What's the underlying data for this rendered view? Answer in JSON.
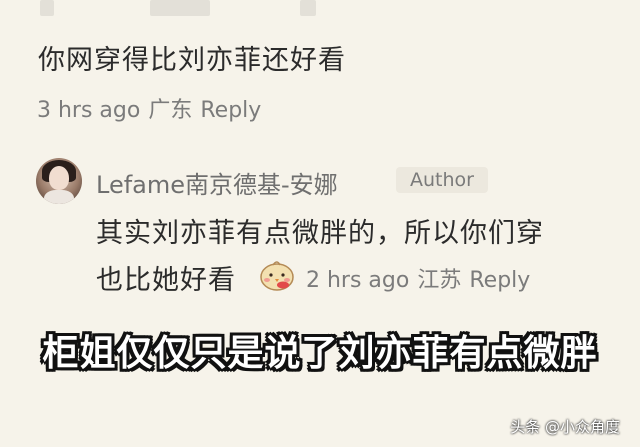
{
  "comment": {
    "text": "你网穿得比刘亦菲还好看",
    "time": "3 hrs ago",
    "location": "广东",
    "reply_label": "Reply"
  },
  "author_reply": {
    "name": "Lefame南京德基-安娜",
    "badge": "Author",
    "text_line1": "其实刘亦菲有点微胖的，所以你们穿",
    "text_line2": "也比她好看",
    "emoji": "blushing-chick-emoji",
    "time": "2 hrs ago",
    "location": "江苏",
    "reply_label": "Reply"
  },
  "caption": {
    "text": "柜姐仅仅只是说了刘亦菲有点微胖"
  },
  "watermark": {
    "text": "头条 @小众角度"
  }
}
